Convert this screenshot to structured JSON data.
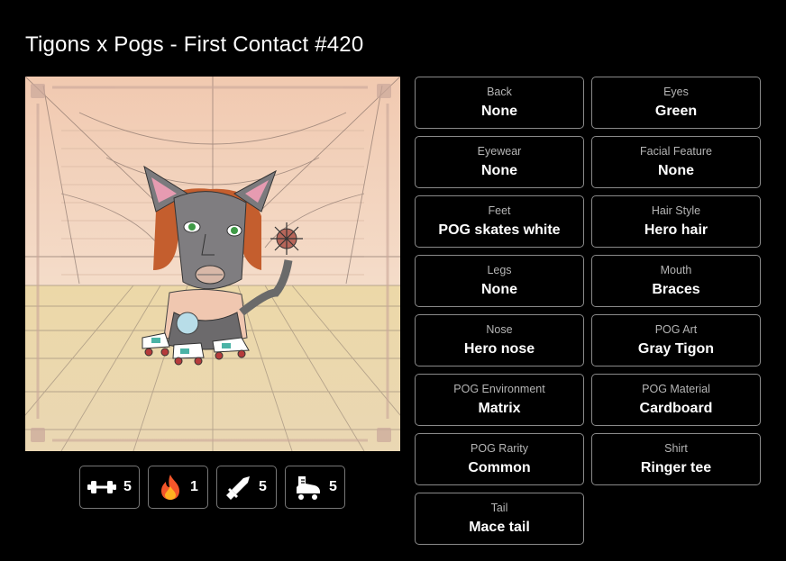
{
  "title": "Tigons x Pogs - First Contact #420",
  "stats": [
    {
      "icon": "dumbbell-icon",
      "value": "5"
    },
    {
      "icon": "fire-icon",
      "value": "1"
    },
    {
      "icon": "sword-icon",
      "value": "5"
    },
    {
      "icon": "skate-icon",
      "value": "5"
    }
  ],
  "traits": [
    {
      "key": "Back",
      "value": "None"
    },
    {
      "key": "Eyes",
      "value": "Green"
    },
    {
      "key": "Eyewear",
      "value": "None"
    },
    {
      "key": "Facial Feature",
      "value": "None"
    },
    {
      "key": "Feet",
      "value": "POG skates white"
    },
    {
      "key": "Hair Style",
      "value": "Hero hair"
    },
    {
      "key": "Legs",
      "value": "None"
    },
    {
      "key": "Mouth",
      "value": "Braces"
    },
    {
      "key": "Nose",
      "value": "Hero nose"
    },
    {
      "key": "POG Art",
      "value": "Gray Tigon"
    },
    {
      "key": "POG Environment",
      "value": "Matrix"
    },
    {
      "key": "POG Material",
      "value": "Cardboard"
    },
    {
      "key": "POG Rarity",
      "value": "Common"
    },
    {
      "key": "Shirt",
      "value": "Ringer tee"
    },
    {
      "key": "Tail",
      "value": "Mace tail"
    }
  ]
}
